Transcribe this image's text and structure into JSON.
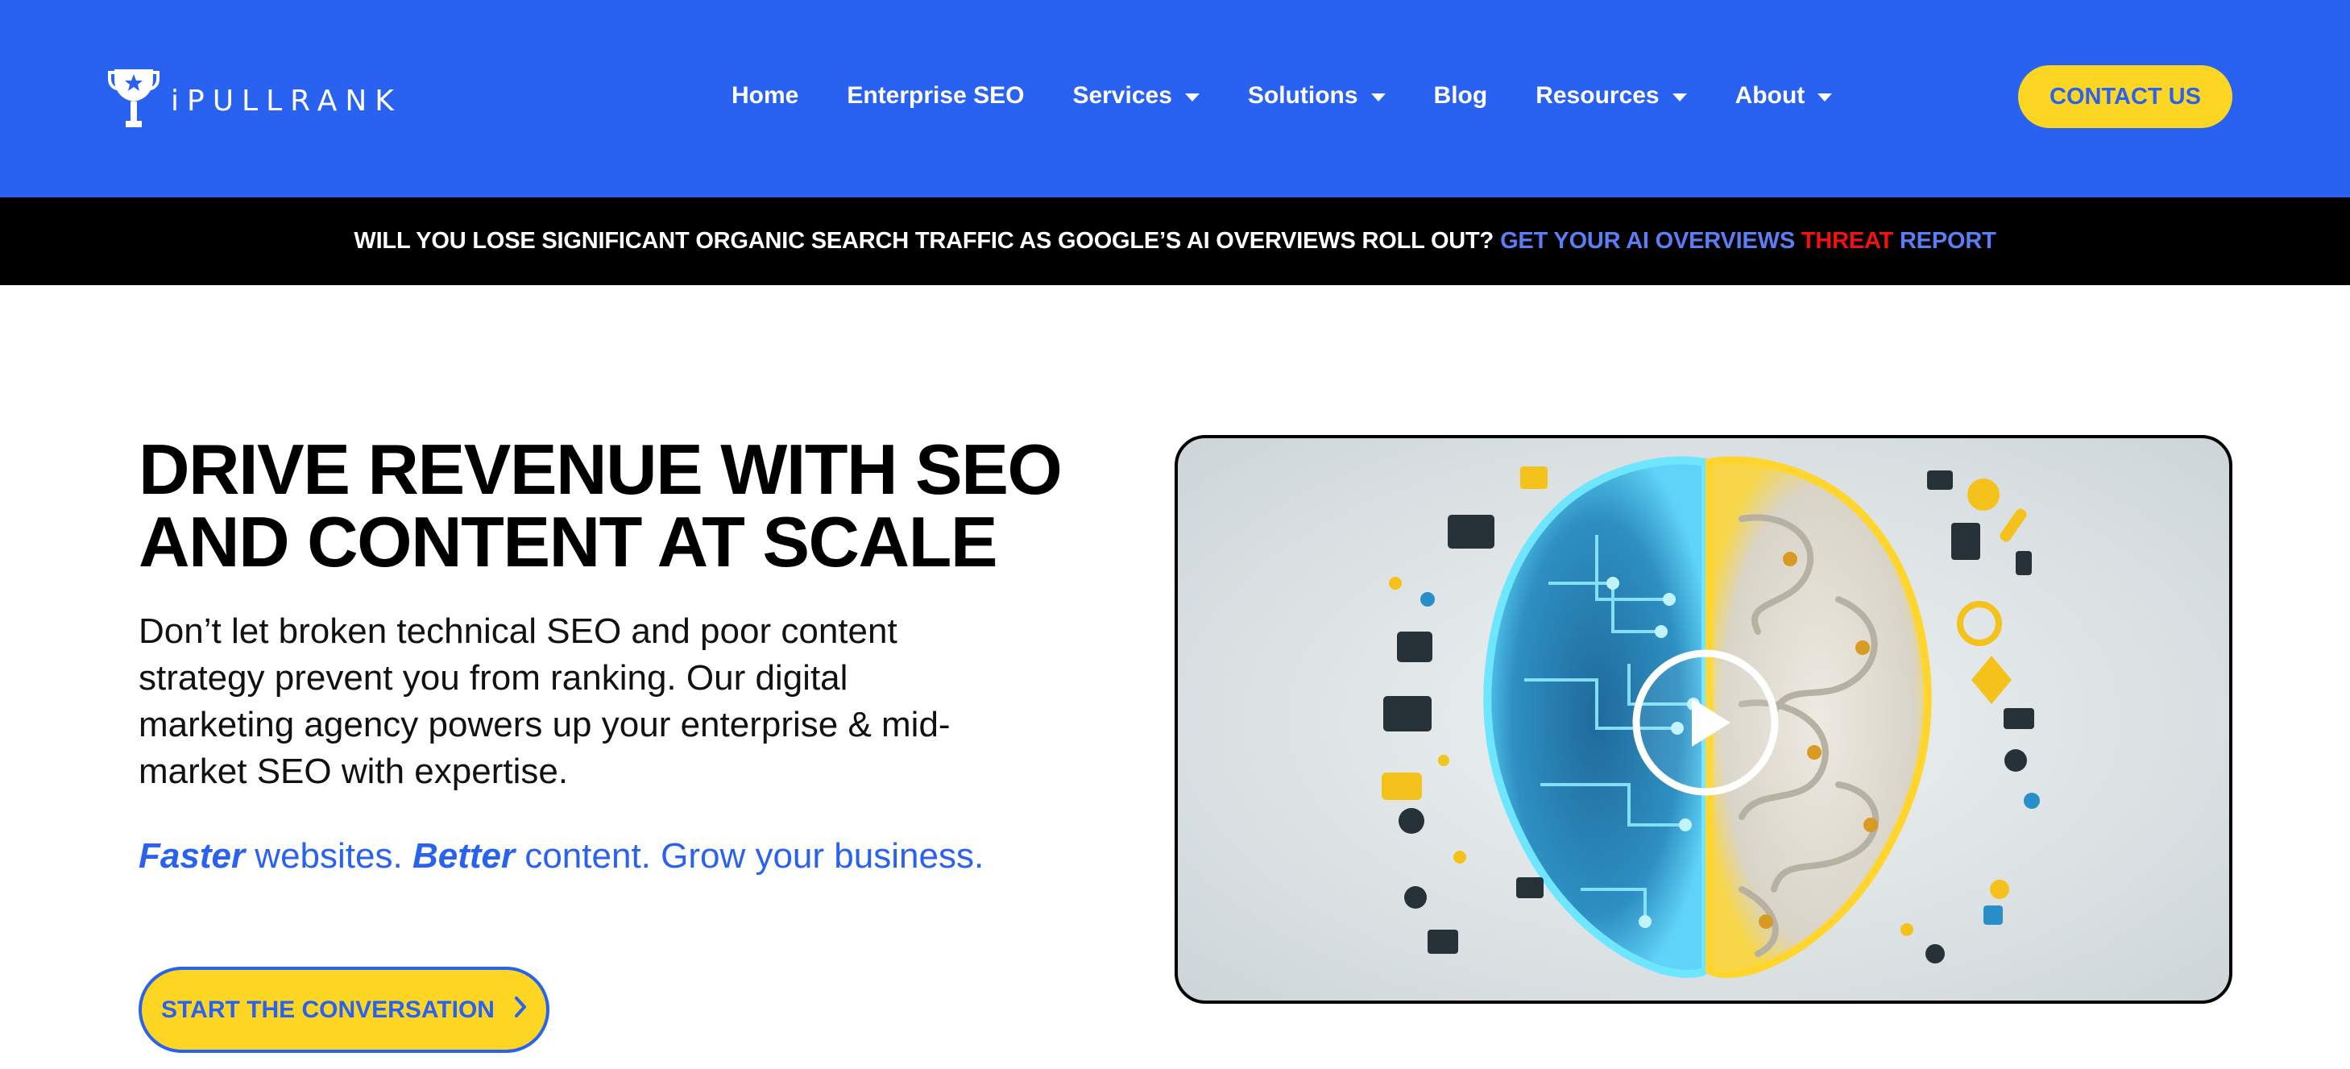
{
  "header": {
    "logo_text": "iPULLRANK",
    "nav": [
      {
        "label": "Home",
        "dropdown": false
      },
      {
        "label": "Enterprise SEO",
        "dropdown": false
      },
      {
        "label": "Services",
        "dropdown": true
      },
      {
        "label": "Solutions",
        "dropdown": true
      },
      {
        "label": "Blog",
        "dropdown": false
      },
      {
        "label": "Resources",
        "dropdown": true
      },
      {
        "label": "About",
        "dropdown": true
      }
    ],
    "contact_label": "CONTACT US"
  },
  "announcement": {
    "question": "WILL YOU LOSE SIGNIFICANT ORGANIC SEARCH TRAFFIC AS GOOGLE’S AI OVERVIEWS ROLL OUT?",
    "link_part1": "GET YOUR AI OVERVIEWS",
    "link_part2": "THREAT",
    "link_part3": "REPORT"
  },
  "hero": {
    "title_lines": [
      "DRIVE REVENUE WITH SEO",
      "AND CONTENT AT SCALE"
    ],
    "description_lines": [
      "Don’t let broken technical SEO and poor content",
      "strategy prevent you from ranking. Our digital",
      "marketing agency powers up your enterprise & mid-",
      "market SEO with expertise."
    ],
    "tagline": {
      "em1": "Faster",
      "t1": " websites. ",
      "em2": "Better",
      "t2": " content. Grow your business."
    },
    "cta_label": "START THE CONVERSATION"
  },
  "icons": {
    "logo": "trophy-icon",
    "caret": "caret-down-icon",
    "cta": "chevron-right-icon",
    "video": "play-icon"
  },
  "colors": {
    "brand_blue": "#2961F0",
    "accent_yellow": "#FDD623",
    "announcement_bg": "#000000",
    "link_blue": "#5C7EF5",
    "threat_red": "#F21010"
  }
}
